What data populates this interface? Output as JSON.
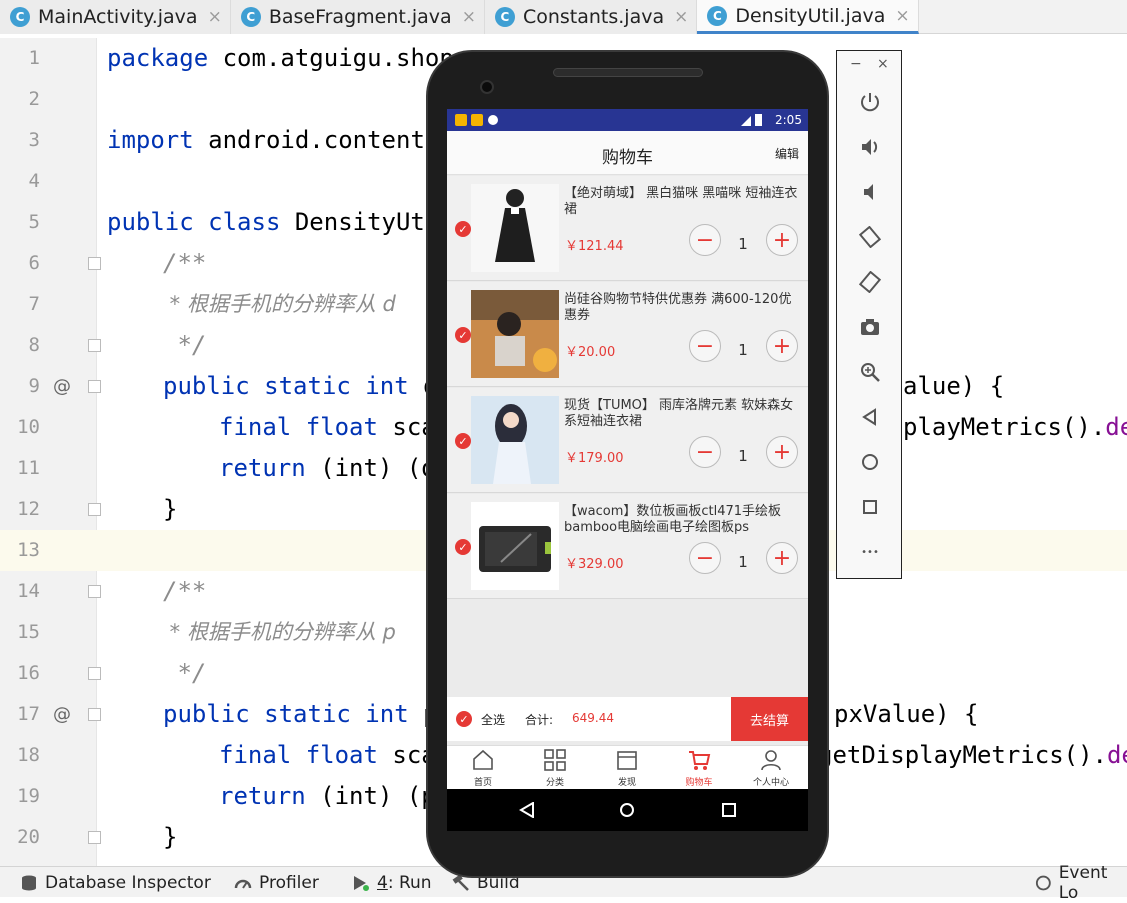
{
  "tabs": [
    {
      "label": "MainActivity.java",
      "active": false
    },
    {
      "label": "BaseFragment.java",
      "active": false
    },
    {
      "label": "Constants.java",
      "active": false
    },
    {
      "label": "DensityUtil.java",
      "active": true
    }
  ],
  "tab_icon_letter": "C",
  "tab_close": "×",
  "editor": {
    "line_numbers": [
      "1",
      "2",
      "3",
      "4",
      "5",
      "6",
      "7",
      "8",
      "9",
      "10",
      "11",
      "12",
      "13",
      "14",
      "15",
      "16",
      "17",
      "18",
      "19",
      "20"
    ],
    "override_marker": "@",
    "lines": {
      "l1": {
        "kw": "package",
        "rest": " com.atguigu.shop"
      },
      "l3": {
        "kw": "import",
        "rest": " android.content."
      },
      "l5": {
        "kw": "public class",
        "rest": " DensityUti"
      },
      "l6": "/**",
      "l7": " * 根据手机的分辨率从 d",
      "l8": " */",
      "l9": {
        "kw": "public static int",
        "rest": " d",
        "tail": "alue) {"
      },
      "l10": {
        "kw": "final float",
        "rest": " sca",
        "tail": "playMetrics().",
        "tail2": "de"
      },
      "l11": {
        "kw": "return",
        "rest": " (int) (d"
      },
      "l12": "}",
      "l14": "/**",
      "l15": " * 根据手机的分辨率从 p",
      "l16": " */",
      "l17": {
        "kw": "public static int",
        "rest": " p",
        "tail": "pxValue) {"
      },
      "l18": {
        "kw": "final float",
        "rest": " sca",
        "tail": "getDisplayMetrics().",
        "tail2": "de"
      },
      "l19": {
        "kw": "return",
        "rest": " (int) (p"
      },
      "l20": "}"
    }
  },
  "statusbar": {
    "db_inspector": "Database Inspector",
    "profiler": "Profiler",
    "run_num": "4",
    "run_label": ": Run",
    "build": "Build",
    "event_log": "Event Lo"
  },
  "phone": {
    "clock": "2:05",
    "title": "购物车",
    "edit": "编辑",
    "items": [
      {
        "name": "【绝对萌域】 黑白猫咪 黑喵咪 短袖连衣裙",
        "price": "￥121.44",
        "qty": "1"
      },
      {
        "name": "尚硅谷购物节特供优惠券  满600-120优惠券",
        "price": "￥20.00",
        "qty": "1"
      },
      {
        "name": "现货【TUMO】 雨库洛牌元素 软妹森女系短袖连衣裙",
        "price": "￥179.00",
        "qty": "1"
      },
      {
        "name": "【wacom】数位板画板ctl471手绘板bamboo电脑绘画电子绘图板ps",
        "price": "￥329.00",
        "qty": "1"
      }
    ],
    "minus": "−",
    "plus": "+",
    "select_all": "全选",
    "total_label": "合计:",
    "total_value": "649.44",
    "checkout": "去结算",
    "nav": [
      "首页",
      "分类",
      "发现",
      "购物车",
      "个人中心"
    ],
    "accent": "#e53935"
  },
  "emulator": {
    "minimize": "−",
    "close": "×",
    "more": "•••"
  }
}
